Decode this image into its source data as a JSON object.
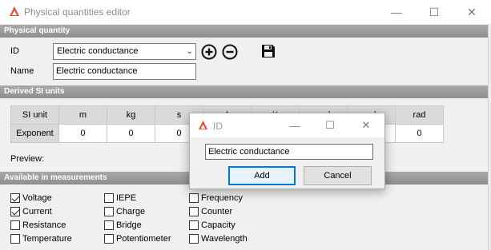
{
  "window": {
    "title": "Physical quantities editor",
    "caption_minimize": "—",
    "caption_maximize": "☐",
    "caption_close": "✕"
  },
  "physical_quantity": {
    "header": "Physical quantity",
    "id_label": "ID",
    "id_value": "Electric conductance",
    "name_label": "Name",
    "name_value": "Electric conductance"
  },
  "derived_si": {
    "header": "Derived SI units",
    "columns": [
      "SI unit",
      "m",
      "kg",
      "s",
      "A",
      "K",
      "mol",
      "cd",
      "rad"
    ],
    "row_label": "Exponent",
    "exponents": [
      "0",
      "0",
      "0",
      "",
      "",
      "",
      "",
      "0"
    ],
    "preview_label": "Preview:"
  },
  "available": {
    "header": "Available in measurements",
    "columns": [
      [
        {
          "label": "Voltage",
          "checked": true
        },
        {
          "label": "Current",
          "checked": true
        },
        {
          "label": "Resistance",
          "checked": false
        },
        {
          "label": "Temperature",
          "checked": false
        }
      ],
      [
        {
          "label": "IEPE",
          "checked": false
        },
        {
          "label": "Charge",
          "checked": false
        },
        {
          "label": "Bridge",
          "checked": false
        },
        {
          "label": "Potentiometer",
          "checked": false
        }
      ],
      [
        {
          "label": "Frequency",
          "checked": false
        },
        {
          "label": "Counter",
          "checked": false
        },
        {
          "label": "Capacity",
          "checked": false
        },
        {
          "label": "Wavelength",
          "checked": false
        }
      ]
    ]
  },
  "dialog": {
    "title": "ID",
    "input_value": "Electric conductance",
    "add_label": "Add",
    "cancel_label": "Cancel",
    "caption_minimize": "—",
    "caption_maximize": "☐",
    "caption_close": "✕"
  },
  "icons": {
    "app": "app-logo-icon",
    "add": "plus-circle-icon",
    "remove": "minus-circle-icon",
    "save": "floppy-disk-icon"
  },
  "colors": {
    "section_header": "#9a9a9a",
    "logo": "#e8502e",
    "dialog_default_border": "#0078d7"
  }
}
